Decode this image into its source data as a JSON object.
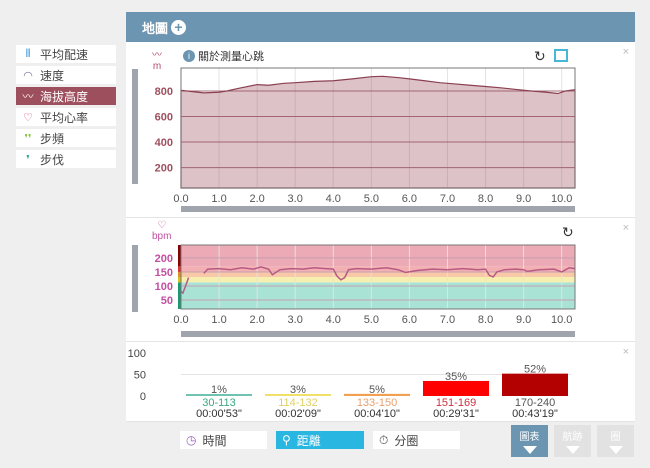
{
  "sidebar": {
    "items": [
      {
        "label": "平均配速",
        "icon": "footprints-icon",
        "color": "#2a8fd6",
        "active": false
      },
      {
        "label": "速度",
        "icon": "speedometer-icon",
        "color": "#7a6aa0",
        "active": false
      },
      {
        "label": "海拔高度",
        "icon": "elevation-icon",
        "color": "#ffffff",
        "active": true
      },
      {
        "label": "平均心率",
        "icon": "heart-icon",
        "color": "#d9487e",
        "active": false
      },
      {
        "label": "步頻",
        "icon": "cadence-icon",
        "color": "#8cc63f",
        "active": false
      },
      {
        "label": "步伐",
        "icon": "stride-icon",
        "color": "#22a98a",
        "active": false
      }
    ]
  },
  "header": {
    "title": "地圖"
  },
  "elevation": {
    "unit": "m",
    "info": "關於測量心跳"
  },
  "heart": {
    "unit": "bpm"
  },
  "chart_data": [
    {
      "type": "area",
      "title": "海拔高度",
      "ylabel": "m",
      "xlim": [
        0,
        10.35
      ],
      "ylim": [
        40,
        980
      ],
      "yticks": [
        "800",
        "600",
        "400",
        "200"
      ],
      "ytick_values": [
        800,
        600,
        400,
        200
      ],
      "xticks": [
        "0.0",
        "1.0",
        "2.0",
        "3.0",
        "4.0",
        "5.0",
        "6.0",
        "7.0",
        "8.0",
        "9.0",
        "10.0"
      ],
      "x": [
        0,
        0.3,
        0.6,
        1.0,
        1.2,
        1.5,
        2.0,
        2.3,
        2.7,
        3.0,
        3.5,
        4.0,
        4.5,
        5.0,
        5.3,
        5.7,
        6.0,
        6.4,
        6.8,
        7.2,
        7.6,
        8.0,
        8.4,
        8.8,
        9.2,
        9.6,
        9.9,
        10.1,
        10.35
      ],
      "y": [
        805,
        795,
        785,
        790,
        800,
        820,
        850,
        845,
        860,
        865,
        875,
        880,
        895,
        912,
        915,
        905,
        895,
        880,
        865,
        855,
        845,
        835,
        825,
        812,
        800,
        790,
        780,
        800,
        810
      ]
    },
    {
      "type": "line",
      "title": "心率",
      "ylabel": "bpm",
      "xlim": [
        0,
        10.35
      ],
      "ylim": [
        18,
        246
      ],
      "yticks": [
        "200",
        "150",
        "100",
        "50"
      ],
      "ytick_values": [
        200,
        150,
        100,
        50
      ],
      "xticks": [
        "0.0",
        "1.0",
        "2.0",
        "3.0",
        "4.0",
        "5.0",
        "6.0",
        "7.0",
        "8.0",
        "9.0",
        "10.0"
      ],
      "zones": [
        {
          "from": 18,
          "to": 113,
          "color": "#a9e3d6"
        },
        {
          "from": 113,
          "to": 132,
          "color": "#f6efb0"
        },
        {
          "from": 132,
          "to": 150,
          "color": "#f8c9a8"
        },
        {
          "from": 150,
          "to": 170,
          "color": "#f3b0b2"
        },
        {
          "from": 170,
          "to": 246,
          "color": "#ebaab5"
        }
      ],
      "segments": [
        {
          "x": [
            0,
            0.05,
            0.12,
            0.2
          ],
          "y": [
            80,
            75,
            100,
            130
          ]
        },
        {
          "x": [
            0.6,
            0.7,
            1.0,
            1.3,
            1.6,
            1.9,
            2.1,
            2.3,
            2.4,
            2.6,
            2.9,
            3.2,
            3.5,
            3.8,
            4.0,
            4.1,
            4.2,
            4.3,
            4.4,
            4.6,
            5.0,
            5.4,
            5.7,
            5.9,
            6.2,
            6.6,
            7.0,
            7.4,
            7.8,
            8.0,
            8.1,
            8.2,
            8.3,
            8.5,
            8.8,
            9.0,
            9.1,
            9.4,
            9.8,
            10.0,
            10.2,
            10.35
          ],
          "y": [
            145,
            160,
            162,
            158,
            165,
            160,
            168,
            160,
            140,
            158,
            162,
            160,
            165,
            162,
            160,
            135,
            122,
            130,
            158,
            162,
            160,
            165,
            158,
            148,
            155,
            160,
            158,
            162,
            158,
            160,
            138,
            132,
            150,
            158,
            160,
            158,
            152,
            158,
            160,
            150,
            165,
            162
          ]
        }
      ]
    },
    {
      "type": "bar",
      "title": "心率區間",
      "ylim": [
        0,
        100
      ],
      "yticks": [
        "100",
        "50",
        "0"
      ],
      "ytick_values": [
        100,
        50,
        0
      ],
      "categories": [
        "30-113",
        "114-132",
        "133-150",
        "151-169",
        "170-240"
      ],
      "values": [
        1,
        3,
        5,
        35,
        52
      ],
      "value_labels": [
        "1%",
        "3%",
        "5%",
        "35%",
        "52%"
      ],
      "durations": [
        "00:00'53\"",
        "00:02'09\"",
        "00:04'10\"",
        "00:29'31\"",
        "00:43'19\""
      ],
      "colors": [
        "#6fc3b0",
        "#f0e06a",
        "#f0a050",
        "#ff0000",
        "#b30000"
      ],
      "label_colors": [
        "#3aa882",
        "#e0d060",
        "#e8a070",
        "#d03040",
        "#555555"
      ]
    }
  ],
  "bottom": {
    "time": "時間",
    "distance": "距離",
    "laps": "分圈",
    "views": [
      "圖表",
      "航跡",
      "圈"
    ]
  }
}
